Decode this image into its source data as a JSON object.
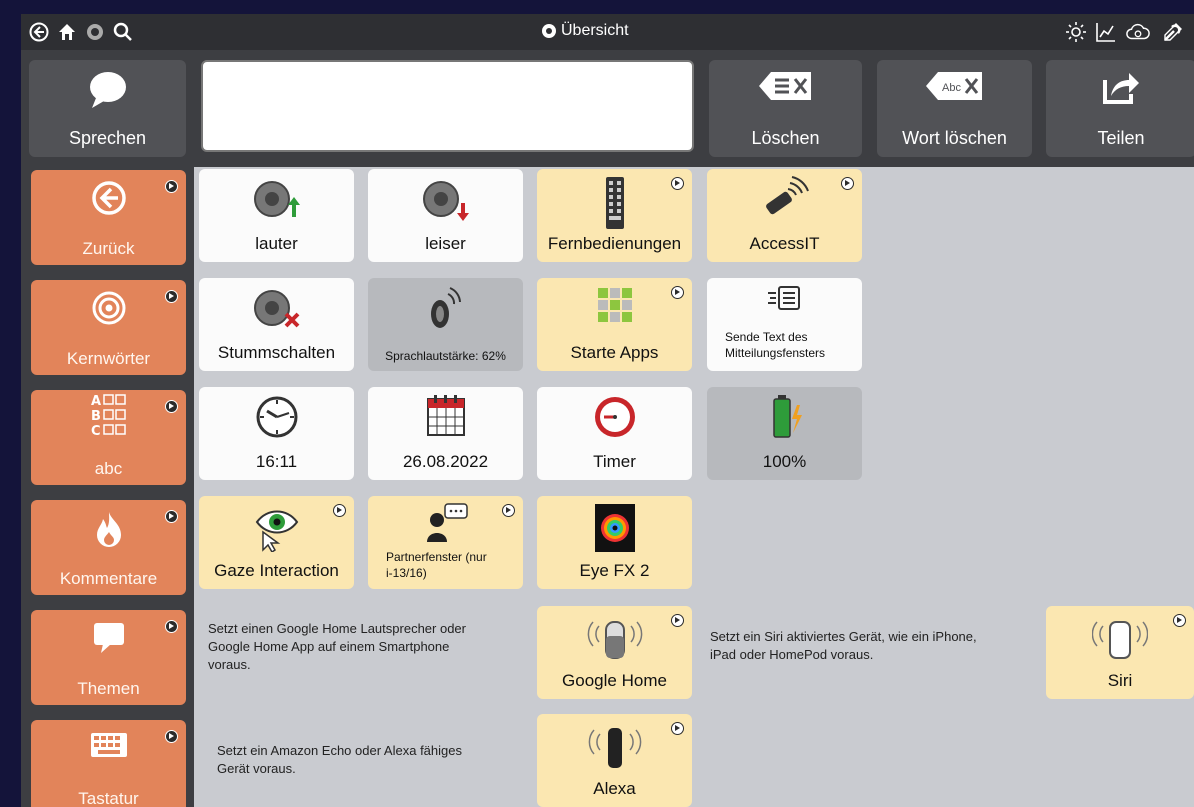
{
  "topbar": {
    "title": "Übersicht",
    "left_icons": [
      "back-icon",
      "home-icon",
      "settings-icon",
      "search-icon"
    ],
    "right_icons": [
      "brightness-icon",
      "chart-icon",
      "cloud-icon",
      "tools-icon"
    ]
  },
  "toolbar": {
    "speak_label": "Sprechen",
    "message_text": "",
    "delete_label": "Löschen",
    "delete_word_label": "Wort löschen",
    "delete_word_icon_text": "Abc",
    "share_label": "Teilen"
  },
  "sidebar": {
    "items": [
      {
        "label": "Zurück",
        "icon": "back-circle-icon"
      },
      {
        "label": "Kernwörter",
        "icon": "target-icon"
      },
      {
        "label": "abc",
        "icon": "abc-grid-icon"
      },
      {
        "label": "Kommentare",
        "icon": "fire-icon"
      },
      {
        "label": "Themen",
        "icon": "speech-bubble-icon"
      },
      {
        "label": "Tastatur",
        "icon": "keyboard-icon"
      }
    ],
    "abc_letters": [
      "A",
      "B",
      "C"
    ]
  },
  "tiles": {
    "louder": "lauter",
    "quieter": "leiser",
    "remotes": "Fernbedienungen",
    "accessit": "AccessIT",
    "mute": "Stummschalten",
    "volume": "Sprachlautstärke: 62%",
    "start_apps": "Starte Apps",
    "send_text_line1": "Sende Text des",
    "send_text_line2": "Mitteilungsfensters",
    "clock": "16:11",
    "date": "26.08.2022",
    "timer": "Timer",
    "battery": "100%",
    "gaze": "Gaze Interaction",
    "partner_line1": "Partnerfenster (nur",
    "partner_line2": "i-13/16)",
    "eyefx": "Eye FX 2",
    "google_home": "Google Home",
    "siri": "Siri",
    "alexa": "Alexa"
  },
  "notes": {
    "google_line1": "Setzt einen Google Home Lautsprecher oder",
    "google_line2": "Google Home App auf einem Smartphone",
    "google_line3": "voraus.",
    "siri_line1": "Setzt ein Siri aktiviertes Gerät, wie ein iPhone,",
    "siri_line2": "iPad oder HomePod voraus.",
    "alexa_line1": "Setzt ein Amazon Echo oder Alexa fähiges",
    "alexa_line2": "Gerät voraus."
  },
  "status": {
    "volume_percent": 62,
    "battery_percent": 100
  },
  "colors": {
    "sidebar_orange": "#e2845a",
    "tile_yellow": "#fbe7b1",
    "tile_white": "#fbfbfb",
    "tile_gray": "#b7b9bd",
    "background": "#c9cbd0"
  }
}
